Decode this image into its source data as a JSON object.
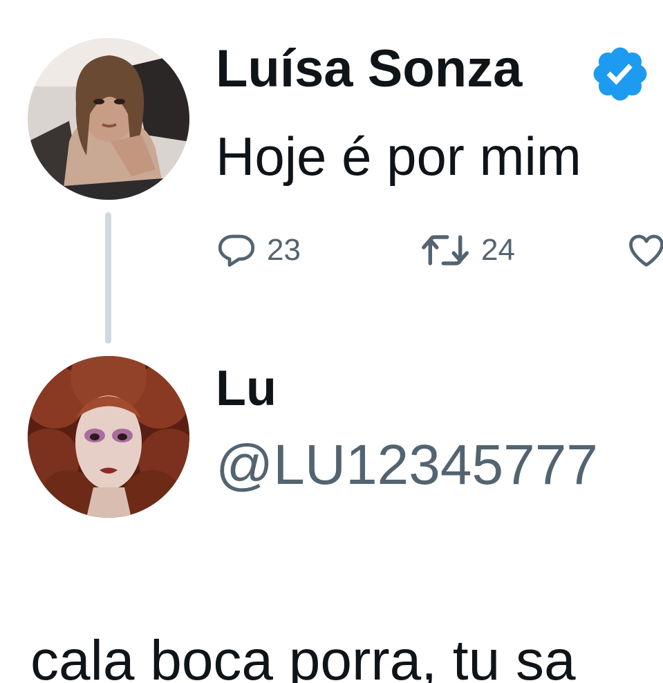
{
  "original_tweet": {
    "author": {
      "display_name": "Luísa Sonza",
      "verified": true,
      "avatar_icon": "profile-photo-woman-wavy-hair"
    },
    "text": "Hoje é por mim",
    "actions": {
      "reply": {
        "icon": "reply-icon",
        "count": "23"
      },
      "retweet": {
        "icon": "retweet-icon",
        "count": "24"
      },
      "like": {
        "icon": "heart-icon"
      }
    }
  },
  "reply_tweet": {
    "author": {
      "display_name": "Lu",
      "handle": "@LU12345777",
      "avatar_icon": "profile-photo-woman-red-curly-hair"
    },
    "text": "cala boca porra, tu sa"
  },
  "colors": {
    "text_primary": "#0f1419",
    "text_secondary": "#536471",
    "verified_blue": "#1d9bf0",
    "thread_line": "#cfd9de"
  }
}
